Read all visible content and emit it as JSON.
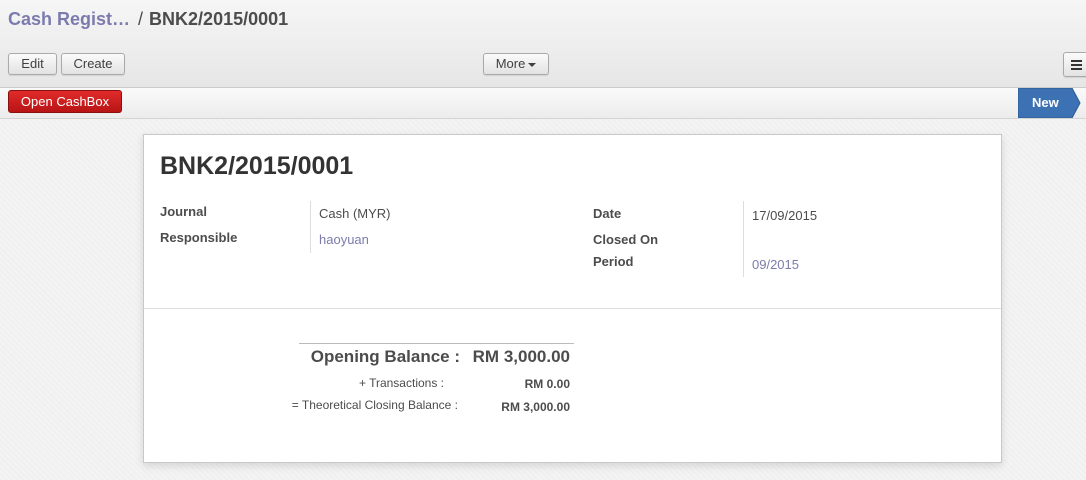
{
  "breadcrumb": {
    "parent": "Cash Regist…",
    "separator": "/",
    "current": "BNK2/2015/0001"
  },
  "toolbar": {
    "edit_label": "Edit",
    "create_label": "Create",
    "more_label": "More"
  },
  "statusbar": {
    "open_cashbox_label": "Open CashBox",
    "stage_label": "New",
    "stage_color": "#3c72b3",
    "cashbox_color": "#c91d1d"
  },
  "record": {
    "title": "BNK2/2015/0001",
    "fields_left": {
      "journal_label": "Journal",
      "journal_value": "Cash (MYR)",
      "responsible_label": "Responsible",
      "responsible_value": "haoyuan"
    },
    "fields_right": {
      "date_label": "Date",
      "date_value": "17/09/2015",
      "closed_on_label": "Closed On",
      "closed_on_value": "",
      "period_label": "Period",
      "period_value": "09/2015"
    }
  },
  "balance": {
    "opening_label": "Opening Balance :",
    "opening_value": "RM 3,000.00",
    "transactions_label": "+ Transactions :",
    "transactions_value": "RM 0.00",
    "closing_label": "= Theoretical Closing Balance :",
    "closing_value": "RM 3,000.00"
  },
  "colors": {
    "link": "#7c7bad",
    "text": "#4c4c4c"
  }
}
